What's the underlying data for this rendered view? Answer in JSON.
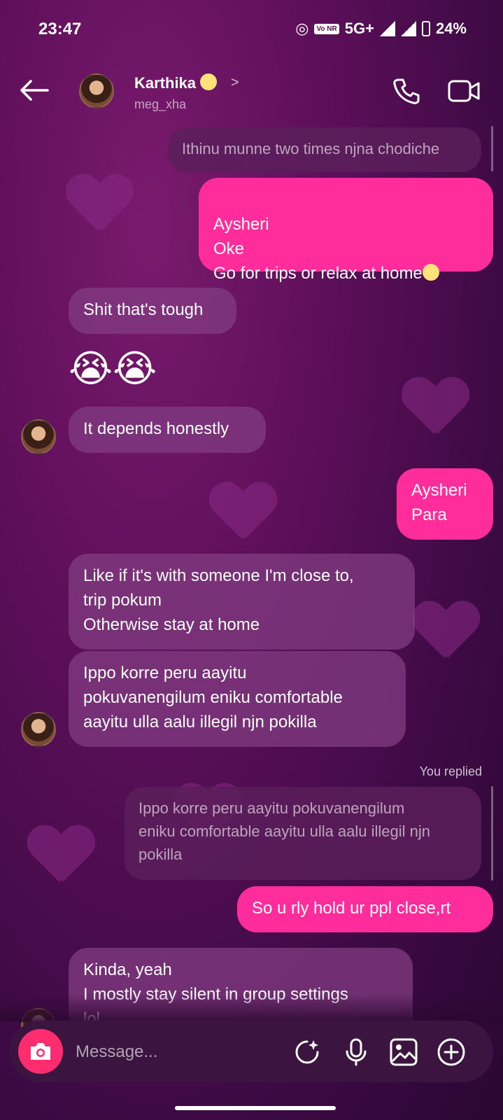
{
  "status_bar": {
    "time": "23:47",
    "vonr": "Vo NR",
    "network": "5G+",
    "battery": "24%"
  },
  "header": {
    "name": "Karthika",
    "username": "meg_xha",
    "chevron": ">"
  },
  "messages": [
    {
      "id": "m1",
      "side": "in",
      "text": "Ithinu munne two times njna chodiche"
    },
    {
      "id": "m2",
      "side": "out",
      "text": "Aysheri\nOke\nGo for trips or relax at home"
    },
    {
      "id": "m3",
      "side": "in",
      "text": "Shit that's tough"
    },
    {
      "id": "m4",
      "side": "in",
      "text": "😭😭"
    },
    {
      "id": "m5",
      "side": "in",
      "text": "It depends honestly"
    },
    {
      "id": "m6",
      "side": "out",
      "text": "Aysheri\nPara"
    },
    {
      "id": "m7",
      "side": "in",
      "text": "Like if it's with someone I'm close to,\ntrip pokum\nOtherwise stay at home"
    },
    {
      "id": "m8",
      "side": "in",
      "text": "Ippo korre peru aayitu\npokuvanengilum eniku comfortable\naayitu ulla aalu illegil njn pokilla"
    },
    {
      "id": "m9",
      "side": "out",
      "text": "So u rly hold ur ppl close,rt"
    },
    {
      "id": "m10",
      "side": "in",
      "text": "Kinda, yeah\nI mostly stay silent in group settings\nlol"
    }
  ],
  "reply": {
    "label": "You replied",
    "quoted": "Ippo korre peru aayitu pokuvanengilum\neniku comfortable aayitu ulla aalu illegil njn\npokilla"
  },
  "composer": {
    "placeholder": "Message..."
  },
  "colors": {
    "outgoing": "#ff2d9b",
    "camera": "#ff2d6f"
  },
  "icons": [
    "back-arrow-icon",
    "phone-icon",
    "video-camera-icon",
    "camera-icon",
    "sticker-sparkle-icon",
    "microphone-icon",
    "gallery-icon",
    "add-circle-icon"
  ]
}
